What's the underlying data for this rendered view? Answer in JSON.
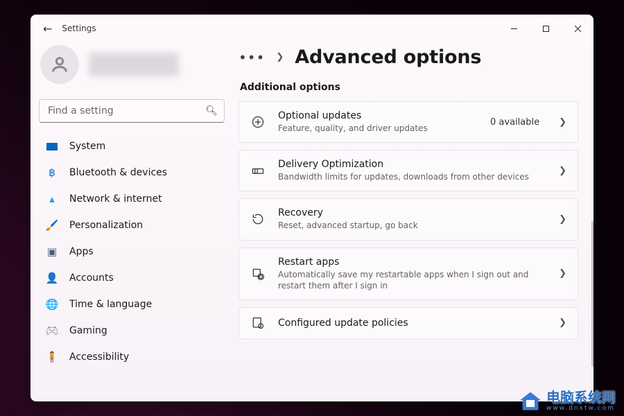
{
  "window": {
    "back_label": "Back",
    "title": "Settings"
  },
  "profile": {
    "display_name": "(redacted)"
  },
  "search": {
    "placeholder": "Find a setting"
  },
  "sidebar": {
    "items": [
      {
        "label": "System",
        "icon": "system"
      },
      {
        "label": "Bluetooth & devices",
        "icon": "bluetooth"
      },
      {
        "label": "Network & internet",
        "icon": "wifi"
      },
      {
        "label": "Personalization",
        "icon": "paint"
      },
      {
        "label": "Apps",
        "icon": "apps"
      },
      {
        "label": "Accounts",
        "icon": "user"
      },
      {
        "label": "Time & language",
        "icon": "globe-clock"
      },
      {
        "label": "Gaming",
        "icon": "gamepad"
      },
      {
        "label": "Accessibility",
        "icon": "accessibility"
      }
    ]
  },
  "breadcrumb": {
    "overflow_label": "More",
    "page_title": "Advanced options"
  },
  "section": {
    "heading": "Additional options"
  },
  "cards": [
    {
      "title": "Optional updates",
      "sub": "Feature, quality, and driver updates",
      "aux": "0 available"
    },
    {
      "title": "Delivery Optimization",
      "sub": "Bandwidth limits for updates, downloads from other devices",
      "aux": ""
    },
    {
      "title": "Recovery",
      "sub": "Reset, advanced startup, go back",
      "aux": ""
    },
    {
      "title": "Restart apps",
      "sub": "Automatically save my restartable apps when I sign out and restart them after I sign in",
      "aux": ""
    },
    {
      "title": "Configured update policies",
      "sub": "",
      "aux": ""
    }
  ],
  "watermark": {
    "text": "电脑系统网",
    "url": "www.dnxtw.com"
  }
}
